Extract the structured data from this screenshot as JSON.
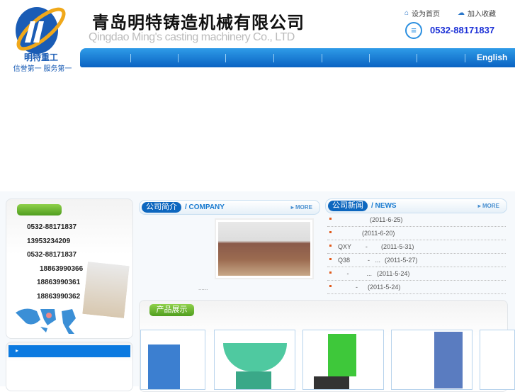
{
  "header": {
    "title": "青岛明特铸造机械有限公司",
    "subtitle": "Qingdao Ming's casting machinery Co., LTD",
    "logo_text": "明特重工",
    "slogan": "信誉第一 服务第一",
    "set_home": "设为首页",
    "add_favorite": "加入收藏",
    "phone": "0532-88171837"
  },
  "nav": {
    "english": "English"
  },
  "contact": {
    "phones": [
      "0532-88171837",
      "13953234209",
      "0532-88171837",
      "18863990366",
      "18863990361",
      "18863990362"
    ]
  },
  "company": {
    "title_cn": "公司简介",
    "title_en": "/ COMPANY",
    "more": "MORE",
    "ellipsis": "......"
  },
  "news": {
    "title_cn": "公司新闻",
    "title_en": "/ NEWS",
    "more": "MORE",
    "items": [
      {
        "text": "",
        "date": "(2011-6-25)"
      },
      {
        "text": "",
        "date": "(2011-6-20)"
      },
      {
        "text": "QXY        -",
        "date": "(2011-5-31)"
      },
      {
        "text": "Q38          -   ...",
        "date": "(2011-5-27)"
      },
      {
        "text": "     -          ...",
        "date": "(2011-5-24)"
      },
      {
        "text": "          -",
        "date": "(2011-5-24)"
      }
    ]
  },
  "products": {
    "title": "产品展示"
  },
  "colors": {
    "nav": "#0a63c2",
    "accent": "#1a7bd0",
    "green": "#6ab533"
  }
}
